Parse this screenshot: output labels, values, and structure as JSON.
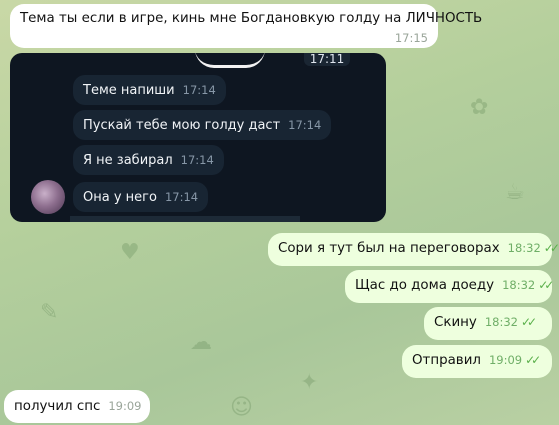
{
  "chat": {
    "messages": [
      {
        "text": "Тема ты если в игре, кинь мне Богдановкую голду на ЛИЧНОСТЬ",
        "time": "17:15"
      },
      {
        "text": "Сори я тут был на переговорах",
        "time": "18:32"
      },
      {
        "text": "Щас до дома доеду",
        "time": "18:32"
      },
      {
        "text": "Скину",
        "time": "18:32"
      },
      {
        "text": "Отправил",
        "time": "19:09"
      },
      {
        "text": "получил спс",
        "time": "19:09"
      }
    ],
    "check_icon": "double-check-icon"
  },
  "screenshot": {
    "date_badge": "17:11",
    "messages": [
      {
        "text": "Теме напиши",
        "time": "17:14"
      },
      {
        "text": "Пускай тебе мою голду даст",
        "time": "17:14"
      },
      {
        "text": "Я не забирал",
        "time": "17:14"
      },
      {
        "text": "Она у него",
        "time": "17:14"
      }
    ]
  },
  "colors": {
    "incoming": "#ffffff",
    "outgoing": "#eeffde",
    "dark_bg": "#0e1621",
    "dark_bubble": "#182533"
  }
}
